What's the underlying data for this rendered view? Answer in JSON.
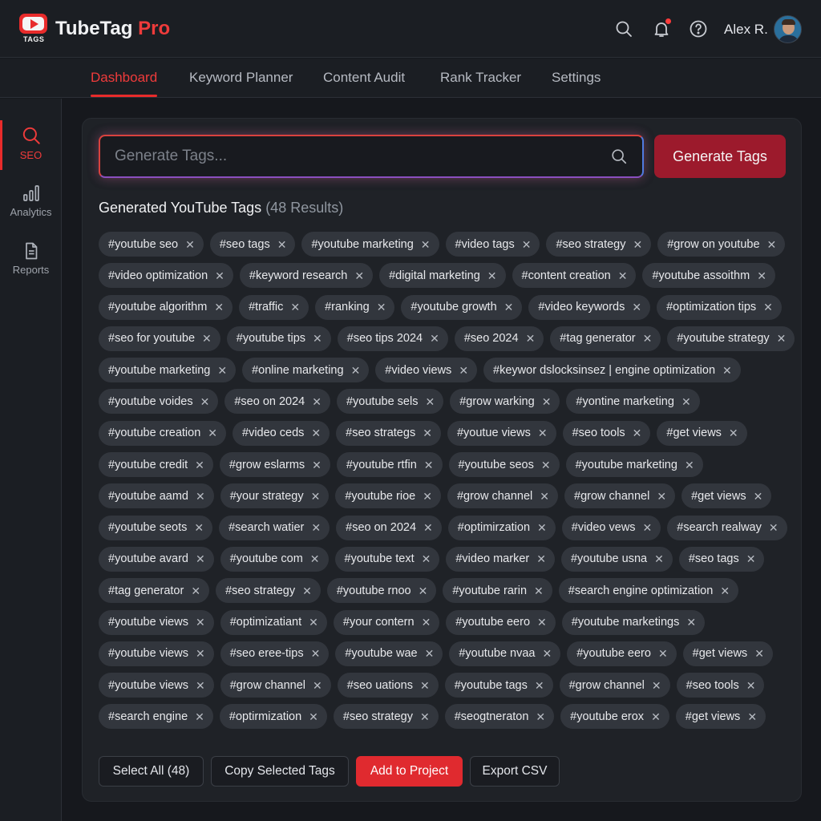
{
  "header": {
    "logo_sub": "TAGS",
    "brand_name": "TubeTag",
    "brand_suffix": "Pro",
    "user_name": "Alex R."
  },
  "nav": {
    "tabs": [
      {
        "label": "Dashboard",
        "active": true
      },
      {
        "label": "Keyword Planner",
        "active": false
      },
      {
        "label": "Content Audit",
        "active": false
      },
      {
        "label": "Rank Tracker",
        "active": false
      },
      {
        "label": "Settings",
        "active": false
      }
    ]
  },
  "sidebar": {
    "items": [
      {
        "label": "SEO",
        "icon": "search-icon",
        "active": true
      },
      {
        "label": "Analytics",
        "icon": "bar-chart-icon",
        "active": false
      },
      {
        "label": "Reports",
        "icon": "document-icon",
        "active": false
      }
    ]
  },
  "search": {
    "placeholder": "Generate Tags...",
    "value": "",
    "button_label": "Generate Tags"
  },
  "results": {
    "title": "Generated YouTube Tags",
    "count_label": "(48 Results)"
  },
  "tag_rows": [
    [
      "#youtube seo",
      "#seo tags",
      "#youtube marketing",
      "#video tags",
      "#seo strategy",
      "#grow on youtube"
    ],
    [
      "#video optimization",
      "#keyword research",
      "#digital marketing",
      "#content creation",
      "#youtube assoithm"
    ],
    [
      "#youtube algorithm",
      "#traffic",
      "#ranking",
      "#youtube growth",
      "#video keywords",
      "#optimization tips"
    ],
    [
      "#seo for youtube",
      "#youtube tips",
      "#seo tips 2024",
      "#seo 2024",
      "#tag generator",
      "#youtube strategy"
    ],
    [
      "#youtube marketing",
      "#online marketing",
      "#video views",
      "#keywor dslocksinsez | engine optimization"
    ],
    [
      "#youtube voides",
      "#seo on 2024",
      "#youtube sels",
      "#grow warking",
      "#yontine marketing"
    ],
    [
      "#youtube creation",
      "#video ceds",
      "#seo strategs",
      "#youtue views",
      "#seo tools",
      "#get views"
    ],
    [
      "#youtube credit",
      "#grow eslarms",
      "#youtube rtfin",
      "#youtube seos",
      "#youtube marketing"
    ],
    [
      "#youtube aamd",
      "#your strategy",
      "#youtube rioe",
      "#grow channel",
      "#grow channel",
      "#get views"
    ],
    [
      "#youtube seots",
      "#search watier",
      "#seo on 2024",
      "#optimirzation",
      "#video vews",
      "#search realway"
    ],
    [
      "#youtube avard",
      "#youtube com",
      "#youtube text",
      "#video marker",
      "#youtube usna",
      "#seo tags"
    ],
    [
      "#tag generator",
      "#seo strategy",
      "#youtube rnoo",
      "#youtube rarin",
      "#search engine optimization"
    ],
    [
      "#youtube views",
      "#optimizatiant",
      "#your contern",
      "#youtube eero",
      "#youtube marketings"
    ],
    [
      "#youtube views",
      "#seo eree-tips",
      "#youtube wae",
      "#youtube nvaa",
      "#youtube eero",
      "#get views"
    ],
    [
      "#youtube views",
      "#grow channel",
      "#seo uations",
      "#youtube tags",
      "#grow channel",
      "#seo tools"
    ],
    [
      "#search engine",
      "#optirmization",
      "#seo strategy",
      "#seogtneraton",
      "#youtube erox",
      "#get views"
    ]
  ],
  "actions": {
    "select_all": "Select All (48)",
    "copy_selected": "Copy Selected Tags",
    "add_to_project": "Add to Project",
    "export_csv": "Export CSV"
  },
  "colors": {
    "accent": "#e82b2b",
    "generate_button": "#9c1a2c",
    "background": "#16181d",
    "panel": "#1f2227",
    "tag_chip": "#32363d"
  }
}
